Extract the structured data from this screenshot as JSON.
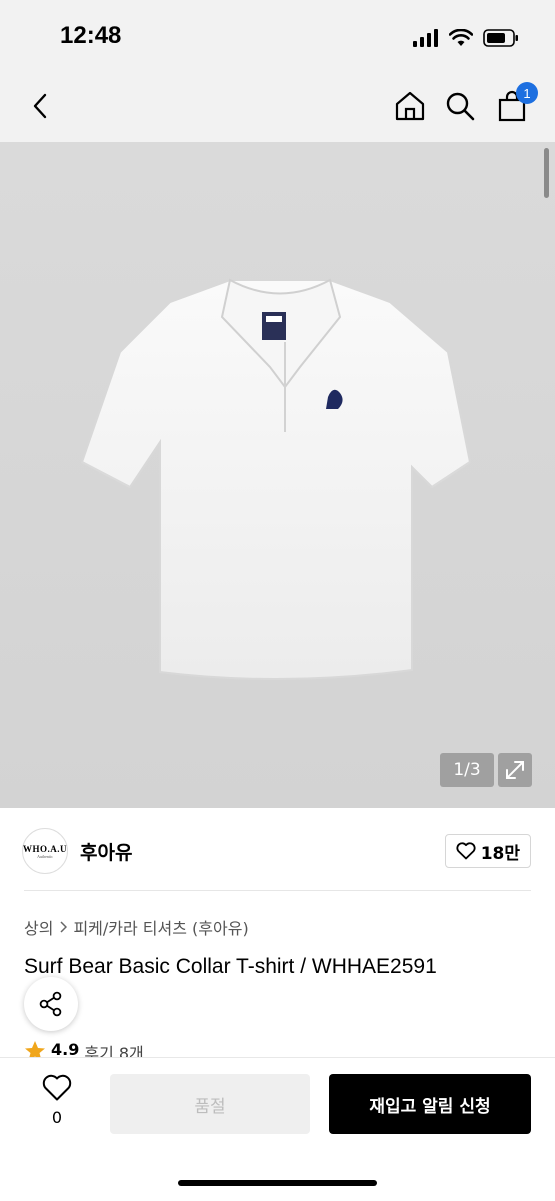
{
  "status_bar": {
    "time": "12:48"
  },
  "gallery": {
    "counter": "1/3"
  },
  "cart": {
    "badge_count": "1"
  },
  "brand": {
    "logo_text": "WHO.A.U",
    "logo_subtext": "Authentic",
    "name": "후아유",
    "like_count": "18만"
  },
  "breadcrumb": {
    "items": [
      "상의",
      "피케/카라 티셔츠 (후아유)"
    ]
  },
  "product": {
    "title": "Surf Bear Basic Collar T-shirt / WHHAE2591"
  },
  "review": {
    "rating": "4.9",
    "text": "후기 8개"
  },
  "bottom": {
    "wish_count": "0",
    "soldout_label": "품절",
    "restock_label": "재입고 알림 신청"
  },
  "colors": {
    "accent": "#1d6fe0",
    "hero_bg": "#d6d6d6",
    "cta_bg": "#000000"
  }
}
